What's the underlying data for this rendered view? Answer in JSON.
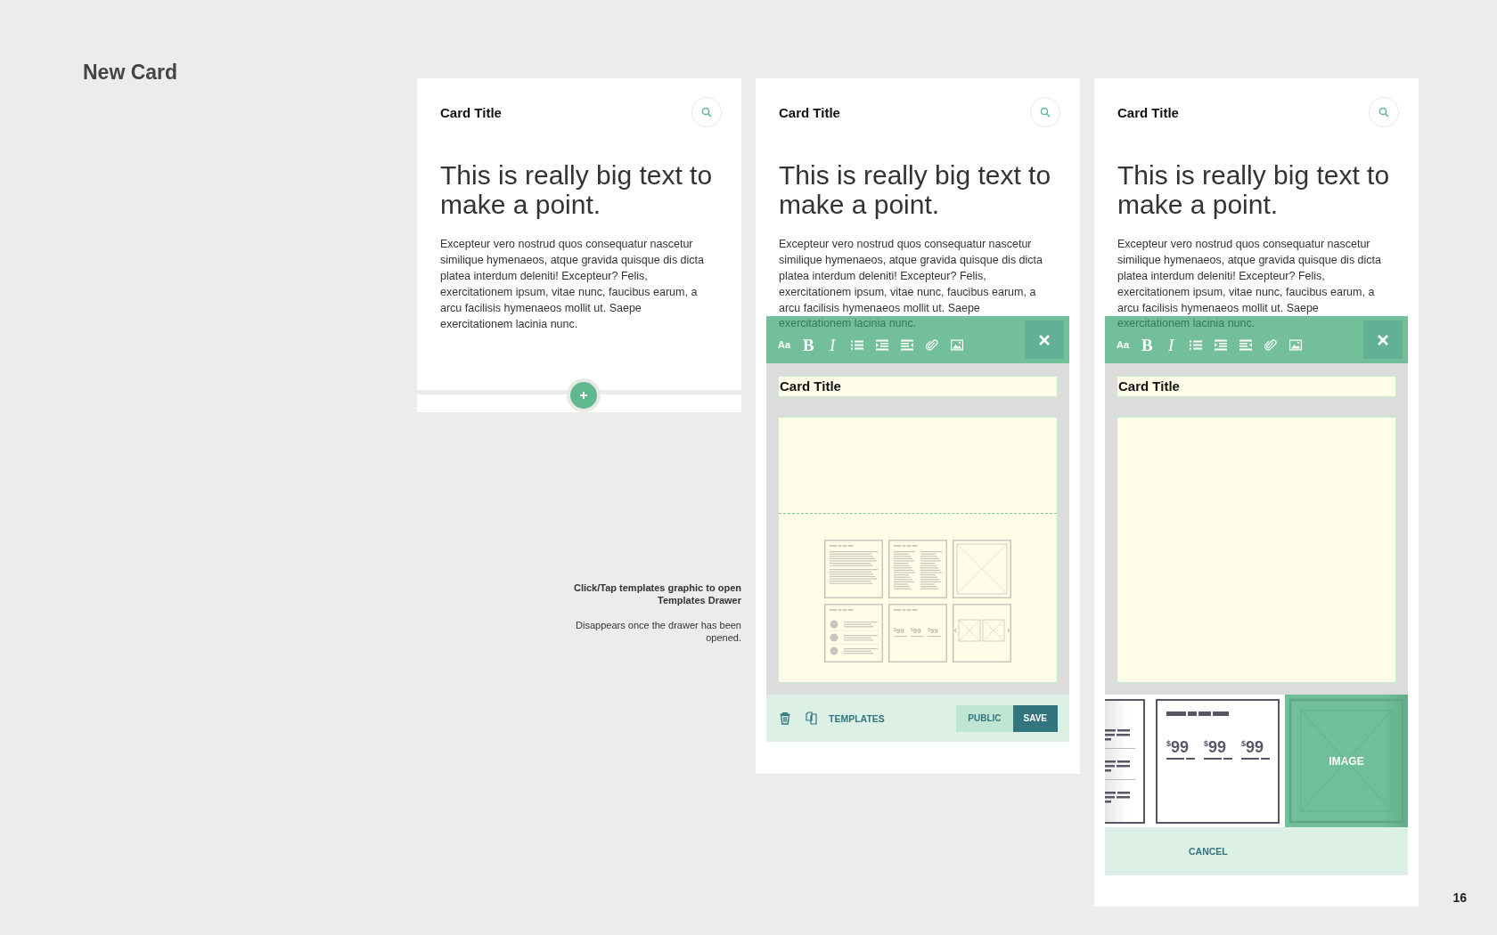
{
  "page": {
    "title": "New Card",
    "page_number": "16"
  },
  "annotation": {
    "heading": "Click/Tap templates graphic to open Templates Drawer",
    "note": "Disappears once the drawer has been opened."
  },
  "cards": [
    {
      "kind": "preview",
      "title": "Card Title",
      "headline": "This is really big text to make a point.",
      "body": "Excepteur vero nostrud quos consequatur nascetur similique hymenaeos, atque gravida quisque dis dicta platea interdum deleniti! Excepteur? Felis, exercitationem ipsum, vitae nunc, faucibus earum, a arcu facilisis hymenaeos mollit ut. Saepe exercitationem lacinia nunc."
    },
    {
      "kind": "editor",
      "title": "Card Title",
      "headline": "This is really big text to make a point.",
      "body": "Excepteur vero nostrud quos consequatur nascetur similique hymenaeos, atque gravida quisque dis dicta platea interdum deleniti! Excepteur? Felis, exercitationem ipsum, vitae nunc, faucibus earum, a arcu facilisis hymenaeos mollit ut. Saepe",
      "covered_text": "exercitationem lacinia nunc.",
      "toolbar": [
        {
          "kind": "font",
          "label": "Aa"
        },
        {
          "kind": "bold",
          "label": "B"
        },
        {
          "kind": "italic",
          "label": "I"
        },
        {
          "kind": "list"
        },
        {
          "kind": "indent"
        },
        {
          "kind": "outdent"
        },
        {
          "kind": "attach"
        },
        {
          "kind": "image"
        }
      ],
      "title_field": "Card Title",
      "templates": [
        {
          "kind": "text"
        },
        {
          "kind": "columns"
        },
        {
          "kind": "image"
        },
        {
          "kind": "list"
        },
        {
          "kind": "pricing",
          "prices": [
            {
              "currency": "$",
              "amount": "99"
            },
            {
              "currency": "$",
              "amount": "99"
            },
            {
              "currency": "$",
              "amount": "99"
            }
          ]
        },
        {
          "kind": "gallery"
        }
      ],
      "footer": {
        "templates_label": "TEMPLATES",
        "public_label": "PUBLIC",
        "save_label": "SAVE"
      }
    },
    {
      "kind": "drawer",
      "title": "Card Title",
      "headline": "This is really big text to make a point.",
      "body": "Excepteur vero nostrud quos consequatur nascetur similique hymenaeos, atque gravida quisque dis dicta platea interdum deleniti! Excepteur? Felis, exercitationem ipsum, vitae nunc, faucibus earum, a arcu facilisis hymenaeos mollit ut. Saepe",
      "covered_text": "exercitationem lacinia nunc.",
      "toolbar": [
        {
          "kind": "font",
          "label": "Aa"
        },
        {
          "kind": "bold",
          "label": "B"
        },
        {
          "kind": "italic",
          "label": "I"
        },
        {
          "kind": "list"
        },
        {
          "kind": "indent"
        },
        {
          "kind": "outdent"
        },
        {
          "kind": "attach"
        },
        {
          "kind": "image"
        }
      ],
      "title_field": "Card Title",
      "drawer": [
        {
          "kind": "list",
          "selected": false
        },
        {
          "kind": "pricing",
          "selected": false,
          "prices": [
            {
              "currency": "$",
              "amount": "99"
            },
            {
              "currency": "$",
              "amount": "99"
            },
            {
              "currency": "$",
              "amount": "99"
            }
          ]
        },
        {
          "kind": "image",
          "label": "IMAGE",
          "selected": true
        }
      ],
      "cancel_label": "CANCEL"
    }
  ]
}
